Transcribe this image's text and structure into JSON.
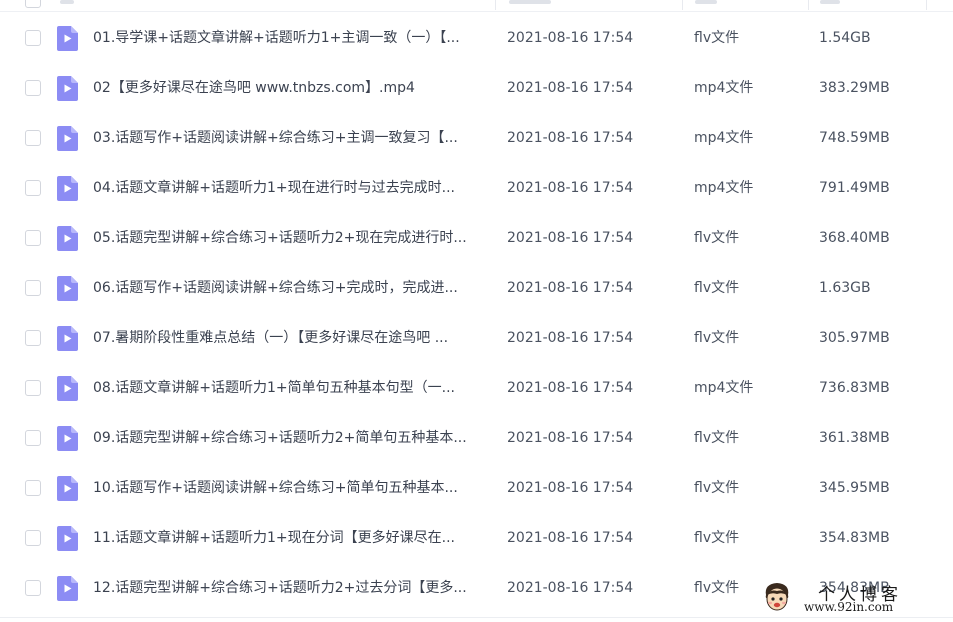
{
  "files": [
    {
      "name": "01.导学课+话题文章讲解+话题听力1+主调一致（一）【...",
      "date": "2021-08-16 17:54",
      "type": "flv文件",
      "size": "1.54GB"
    },
    {
      "name": "02【更多好课尽在途鸟吧 www.tnbzs.com】.mp4",
      "date": "2021-08-16 17:54",
      "type": "mp4文件",
      "size": "383.29MB"
    },
    {
      "name": "03.话题写作+话题阅读讲解+综合练习+主调一致复习【...",
      "date": "2021-08-16 17:54",
      "type": "mp4文件",
      "size": "748.59MB"
    },
    {
      "name": "04.话题文章讲解+话题听力1+现在进行时与过去完成时...",
      "date": "2021-08-16 17:54",
      "type": "mp4文件",
      "size": "791.49MB"
    },
    {
      "name": "05.话题完型讲解+综合练习+话题听力2+现在完成进行时...",
      "date": "2021-08-16 17:54",
      "type": "flv文件",
      "size": "368.40MB"
    },
    {
      "name": "06.话题写作+话题阅读讲解+综合练习+完成时，完成进...",
      "date": "2021-08-16 17:54",
      "type": "flv文件",
      "size": "1.63GB"
    },
    {
      "name": "07.暑期阶段性重难点总结（一）【更多好课尽在途鸟吧 ...",
      "date": "2021-08-16 17:54",
      "type": "flv文件",
      "size": "305.97MB"
    },
    {
      "name": "08.话题文章讲解+话题听力1+简单句五种基本句型（一...",
      "date": "2021-08-16 17:54",
      "type": "mp4文件",
      "size": "736.83MB"
    },
    {
      "name": "09.话题完型讲解+综合练习+话题听力2+简单句五种基本...",
      "date": "2021-08-16 17:54",
      "type": "flv文件",
      "size": "361.38MB"
    },
    {
      "name": "10.话题写作+话题阅读讲解+综合练习+简单句五种基本...",
      "date": "2021-08-16 17:54",
      "type": "flv文件",
      "size": "345.95MB"
    },
    {
      "name": "11.话题文章讲解+话题听力1+现在分词【更多好课尽在...",
      "date": "2021-08-16 17:54",
      "type": "flv文件",
      "size": "354.83MB"
    },
    {
      "name": "12.话题完型讲解+综合练习+话题听力2+过去分词【更多...",
      "date": "2021-08-16 17:54",
      "type": "flv文件",
      "size": "354.83MB"
    }
  ],
  "icons": {
    "file": "video-file-icon",
    "checkbox": "checkbox-icon"
  },
  "colors": {
    "icon_body": "#8c8cf4",
    "icon_fold": "#b9b9fa",
    "icon_play": "#ffffff",
    "text": "#3b4250"
  },
  "watermark": {
    "title": "个人博客",
    "url": "www.92in.com"
  }
}
